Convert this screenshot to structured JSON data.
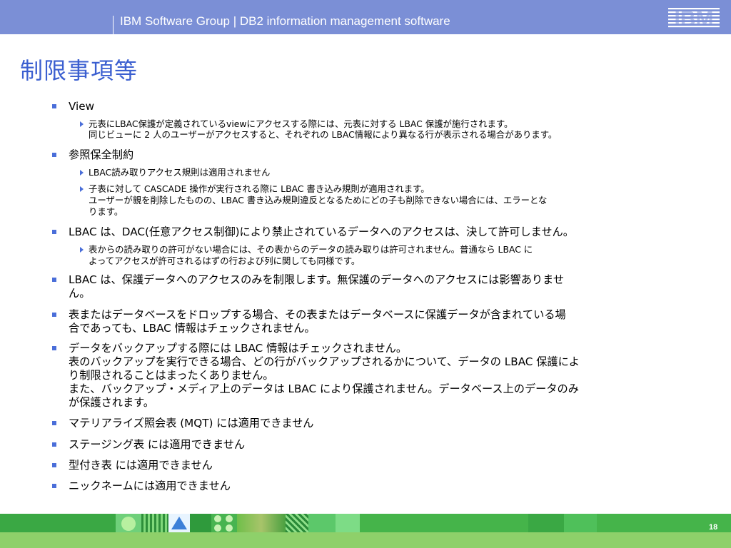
{
  "header": {
    "title": "IBM Software Group | DB2 information management software",
    "logo_text": "IBM"
  },
  "slide": {
    "title": "制限事項等",
    "items": [
      {
        "text": "View",
        "sub": [
          {
            "lines": [
              "元表にLBAC保護が定義されているviewにアクセスする際には、元表に対する LBAC 保護が施行されます。",
              "同じビューに 2 人のユーザーがアクセスすると、それぞれの LBAC情報により異なる行が表示される場合があります。"
            ]
          }
        ]
      },
      {
        "text": "参照保全制約",
        "sub": [
          {
            "lines": [
              "LBAC読み取りアクセス規則は適用されません"
            ]
          },
          {
            "lines": [
              "子表に対して CASCADE 操作が実行される際に LBAC 書き込み規則が適用されます。",
              "ユーザーが親を削除したものの、LBAC 書き込み規則違反となるためにどの子も削除できない場合には、エラーとな",
              "ります。"
            ]
          }
        ]
      },
      {
        "text": "LBAC は、DAC(任意アクセス制御)により禁止されているデータへのアクセスは、決して許可しません。",
        "sub": [
          {
            "lines": [
              "表からの読み取りの許可がない場合には、その表からのデータの読み取りは許可されません。普通なら LBAC に",
              "よってアクセスが許可されるはずの行および列に関しても同様です。"
            ]
          }
        ]
      },
      {
        "lines": [
          "LBAC は、保護データへのアクセスのみを制限します。無保護のデータへのアクセスには影響ありませ",
          "ん。"
        ]
      },
      {
        "lines": [
          "表またはデータベースをドロップする場合、その表またはデータベースに保護データが含まれている場",
          "合であっても、LBAC 情報はチェックされません。"
        ]
      },
      {
        "lines": [
          "データをバックアップする際には LBAC 情報はチェックされません。",
          "表のバックアップを実行できる場合、どの行がバックアップされるかについて、データの LBAC 保護によ",
          "り制限されることはまったくありません。",
          "また、バックアップ・メディア上のデータは LBAC により保護されません。データベース上のデータのみ",
          "が保護されます。"
        ]
      },
      {
        "text": "マテリアライズ照会表 (MQT) には適用できません"
      },
      {
        "text": "ステージング表 には適用できません"
      },
      {
        "text": "型付き表 には適用できません"
      },
      {
        "text": "ニックネームには適用できません"
      }
    ]
  },
  "footer": {
    "page_number": "18"
  },
  "colors": {
    "header": "#7b8fd6",
    "title": "#3b5fd0",
    "bullet": "#4a6ed9",
    "footer": "#45b44a"
  }
}
